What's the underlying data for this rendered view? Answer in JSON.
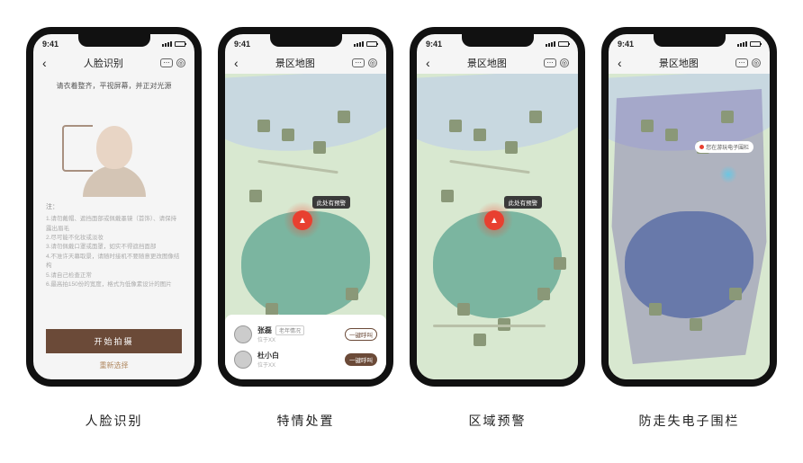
{
  "status": {
    "time": "9:41"
  },
  "screens": [
    {
      "title": "人脸识别",
      "prompt": "请衣着整齐，平视屏幕，并正对光源",
      "notes_title": "注：",
      "notes": [
        "1.请勿戴帽、遮挡面部或佩戴墨镜（首饰）、请保持露出眉毛",
        "2.尽可能不化妆或淡妆",
        "3.请勿佩戴口罩或面罩，如实不得遮挡面部",
        "4.不准许天幕取景，请随时接机不要随意更改图像结构",
        "5.请自己检查正常",
        "6.最高拍150份的宽度，格式为低像素设计的图片"
      ],
      "primary_btn": "开始拍摄",
      "secondary_btn": "重新选择",
      "caption": "人脸识别"
    },
    {
      "title": "景区地图",
      "alert_label": "此处有预警",
      "people": [
        {
          "name": "张磊",
          "tag": "老年情况",
          "sub": "位于XX",
          "btn": "一键呼叫"
        },
        {
          "name": "杜小白",
          "tag": "",
          "sub": "位于XX",
          "btn": "一键呼叫"
        }
      ],
      "caption": "特情处置"
    },
    {
      "title": "景区地图",
      "alert_label": "此处有预警",
      "caption": "区域预警"
    },
    {
      "title": "景区地图",
      "fence_tag": "您在游玩电子围栏",
      "caption": "防走失电子围栏"
    }
  ]
}
